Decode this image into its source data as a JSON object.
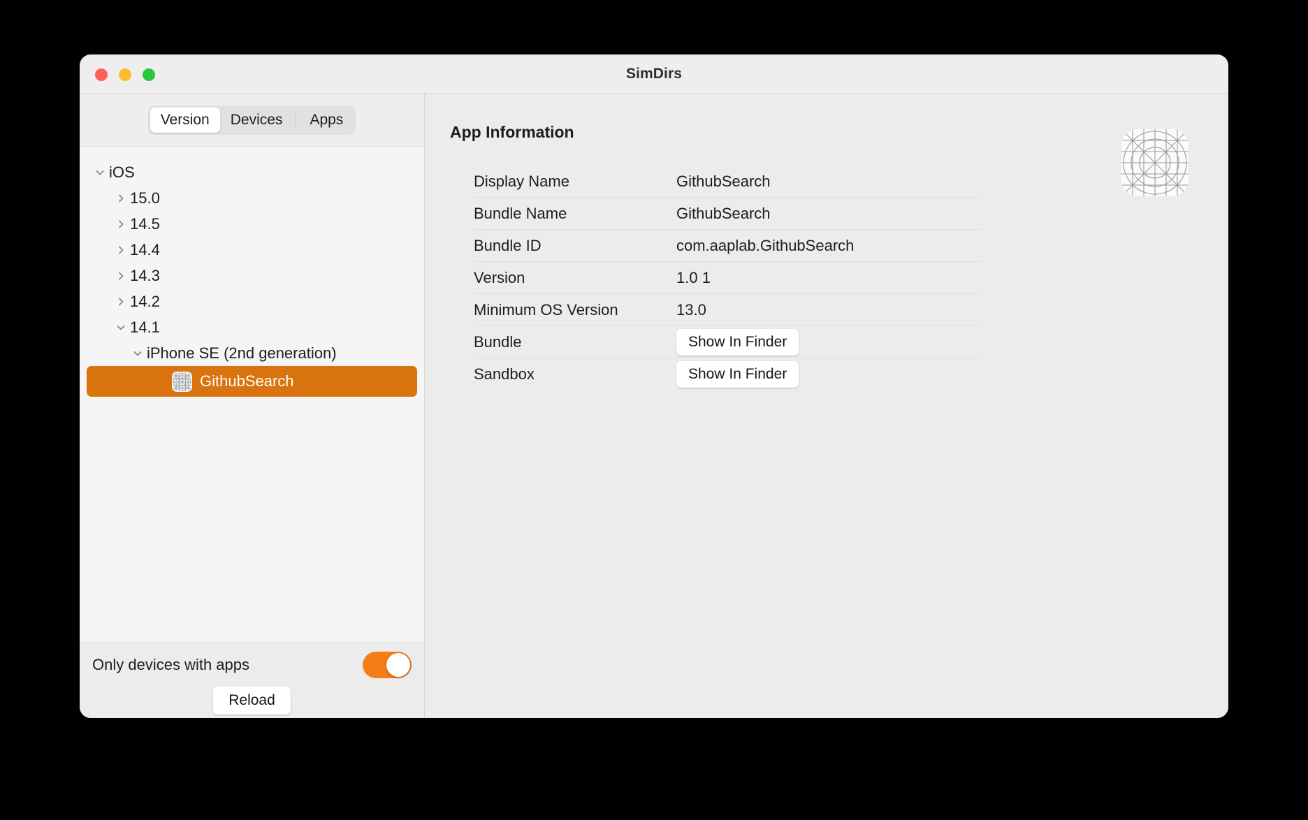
{
  "window": {
    "title": "SimDirs",
    "traffic_lights": [
      {
        "name": "close",
        "color": "#ff5f57"
      },
      {
        "name": "minimize",
        "color": "#febc2e"
      },
      {
        "name": "maximize",
        "color": "#28c840"
      }
    ]
  },
  "sidebar": {
    "segmented_control": {
      "options": [
        "Version",
        "Devices",
        "Apps"
      ],
      "selected": "Version"
    },
    "tree": [
      {
        "label": "iOS",
        "level": 0,
        "state": "expanded",
        "icon": null,
        "selected": false
      },
      {
        "label": "15.0",
        "level": 1,
        "state": "collapsed",
        "icon": null,
        "selected": false
      },
      {
        "label": "14.5",
        "level": 1,
        "state": "collapsed",
        "icon": null,
        "selected": false
      },
      {
        "label": "14.4",
        "level": 1,
        "state": "collapsed",
        "icon": null,
        "selected": false
      },
      {
        "label": "14.3",
        "level": 1,
        "state": "collapsed",
        "icon": null,
        "selected": false
      },
      {
        "label": "14.2",
        "level": 1,
        "state": "collapsed",
        "icon": null,
        "selected": false
      },
      {
        "label": "14.1",
        "level": 1,
        "state": "expanded",
        "icon": null,
        "selected": false
      },
      {
        "label": "iPhone SE (2nd generation)",
        "level": 2,
        "state": "expanded",
        "icon": null,
        "selected": false
      },
      {
        "label": "GithubSearch",
        "level": 3,
        "state": "none",
        "icon": "app-placeholder-icon",
        "selected": true
      }
    ],
    "footer": {
      "toggle_label": "Only devices with apps",
      "toggle_on": true,
      "reload_label": "Reload"
    }
  },
  "main": {
    "title": "App Information",
    "rows": [
      {
        "label": "Display Name",
        "value": "GithubSearch",
        "type": "text"
      },
      {
        "label": "Bundle Name",
        "value": "GithubSearch",
        "type": "text"
      },
      {
        "label": "Bundle ID",
        "value": "com.aaplab.GithubSearch",
        "type": "text"
      },
      {
        "label": "Version",
        "value": "1.0 1",
        "type": "text"
      },
      {
        "label": "Minimum OS Version",
        "value": "13.0",
        "type": "text"
      },
      {
        "label": "Bundle",
        "value": "Show In Finder",
        "type": "button"
      },
      {
        "label": "Sandbox",
        "value": "Show In Finder",
        "type": "button"
      }
    ],
    "app_icon": "app-placeholder-icon"
  },
  "colors": {
    "selection_orange": "#d9730d",
    "toggle_orange": "#f57c17",
    "sidebar_bg": "#f5f5f5",
    "main_bg": "#ececec",
    "titlebar_bg": "#efeeef"
  }
}
